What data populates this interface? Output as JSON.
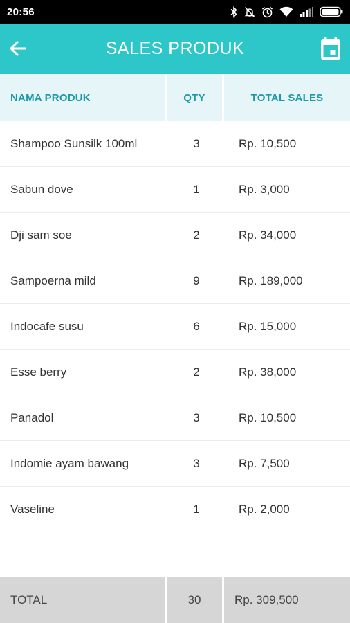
{
  "status_bar": {
    "time": "20:56",
    "icons": [
      "bluetooth-icon",
      "do-not-disturb-icon",
      "alarm-icon",
      "wifi-icon",
      "cell-signal-icon",
      "battery-icon"
    ]
  },
  "app_bar": {
    "title": "SALES PRODUK",
    "back_icon": "arrow-left-icon",
    "calendar_icon": "calendar-icon",
    "color": "#2ec7c9"
  },
  "table": {
    "headers": {
      "name": "NAMA PRODUK",
      "qty": "QTY",
      "total": "TOTAL SALES"
    },
    "rows": [
      {
        "name": "Shampoo Sunsilk 100ml",
        "qty": "3",
        "total": "Rp. 10,500"
      },
      {
        "name": "Sabun dove",
        "qty": "1",
        "total": "Rp. 3,000"
      },
      {
        "name": "Dji sam soe",
        "qty": "2",
        "total": "Rp. 34,000"
      },
      {
        "name": "Sampoerna mild",
        "qty": "9",
        "total": "Rp. 189,000"
      },
      {
        "name": "Indocafe susu",
        "qty": "6",
        "total": "Rp. 15,000"
      },
      {
        "name": "Esse berry",
        "qty": "2",
        "total": "Rp. 38,000"
      },
      {
        "name": "Panadol",
        "qty": "3",
        "total": "Rp. 10,500"
      },
      {
        "name": "Indomie ayam bawang",
        "qty": "3",
        "total": "Rp. 7,500"
      },
      {
        "name": "Vaseline",
        "qty": "1",
        "total": "Rp. 2,000"
      }
    ],
    "footer": {
      "label": "TOTAL",
      "qty": "30",
      "total": "Rp. 309,500"
    }
  }
}
